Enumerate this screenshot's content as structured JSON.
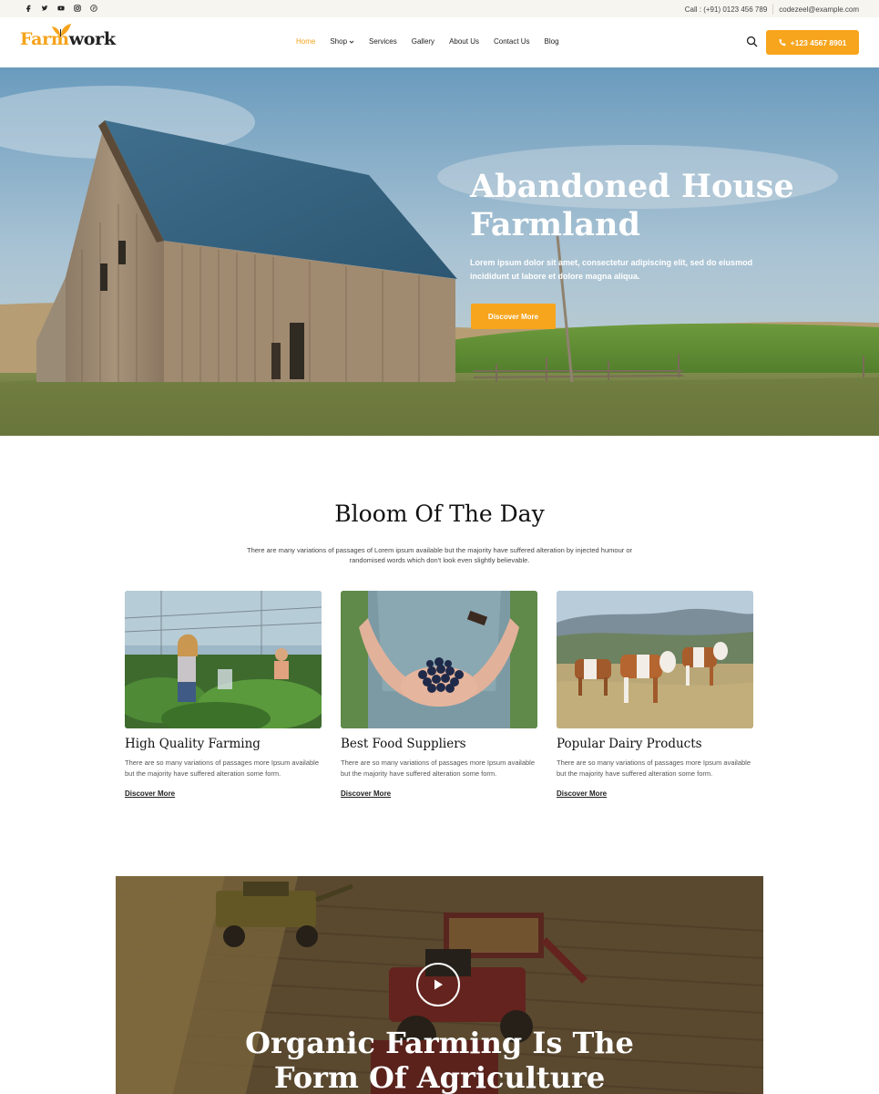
{
  "topbar": {
    "social_icons": [
      "facebook-icon",
      "twitter-icon",
      "youtube-icon",
      "instagram-icon",
      "pinterest-icon"
    ],
    "call_text": "Call : (+91) 0123 456 789",
    "email_text": "codezeel@example.com"
  },
  "header": {
    "logo_part1": "Farm",
    "logo_part2": "work",
    "nav": [
      {
        "label": "Home",
        "active": true
      },
      {
        "label": "Shop",
        "dropdown": true
      },
      {
        "label": "Services"
      },
      {
        "label": "Gallery"
      },
      {
        "label": "About Us"
      },
      {
        "label": "Contact Us"
      },
      {
        "label": "Blog"
      }
    ],
    "phone_button": "+123 4567 8901"
  },
  "hero": {
    "title": "Abandoned House Farmland",
    "text": "Lorem ipsum dolor sit amet, consectetur adipiscing elit, sed do eiusmod incididunt ut labore et dolore magna aliqua.",
    "button": "Discover More"
  },
  "section": {
    "title": "Bloom Of The Day",
    "text": "There are many variations of passages of Lorem ipsum available but the majority have suffered alteration by injected humour or randomised words which don't look even slightly believable.",
    "cards": [
      {
        "title": "High Quality Farming",
        "text": "There are so many variations of passages more Ipsum available but the majority have suffered alteration some form.",
        "link": "Discover More"
      },
      {
        "title": "Best Food Suppliers",
        "text": "There are so many variations of passages more Ipsum available but the majority have suffered alteration some form.",
        "link": "Discover More"
      },
      {
        "title": "Popular Dairy Products",
        "text": "There are so many variations of passages more Ipsum available but the majority have suffered alteration some form.",
        "link": "Discover More"
      }
    ]
  },
  "video": {
    "title_line1": "Organic Farming Is The",
    "title_line2": "Form Of Agriculture"
  },
  "colors": {
    "accent": "#f7a51d",
    "topbar_bg": "#f7f5f0"
  }
}
